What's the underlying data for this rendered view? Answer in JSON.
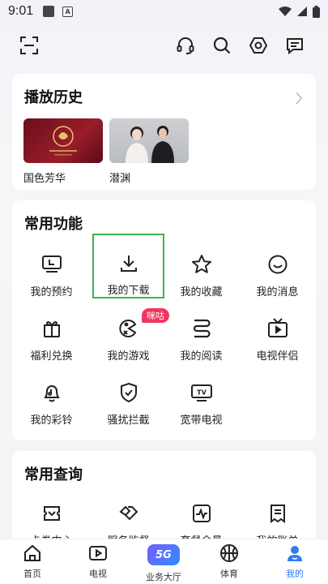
{
  "status_bar": {
    "time": "9:01",
    "notification_icon": "A"
  },
  "top_bar": {
    "icons": [
      "scan-icon",
      "headset-icon",
      "search-icon",
      "settings-icon",
      "message-icon"
    ]
  },
  "history": {
    "title": "播放历史",
    "items": [
      {
        "label": "国色芳华"
      },
      {
        "label": "潜渊"
      }
    ]
  },
  "functions": {
    "title": "常用功能",
    "items": [
      {
        "label": "我的预约",
        "icon": "tv-reserve-icon"
      },
      {
        "label": "我的下载",
        "icon": "download-icon"
      },
      {
        "label": "我的收藏",
        "icon": "star-icon"
      },
      {
        "label": "我的消息",
        "icon": "smile-message-icon"
      },
      {
        "label": "福利兑换",
        "icon": "gift-icon"
      },
      {
        "label": "我的游戏",
        "icon": "game-icon",
        "badge": "咪咕"
      },
      {
        "label": "我的阅读",
        "icon": "book-icon"
      },
      {
        "label": "电视伴侣",
        "icon": "tv-icon"
      },
      {
        "label": "我的彩铃",
        "icon": "bell-icon"
      },
      {
        "label": "骚扰拦截",
        "icon": "shield-icon"
      },
      {
        "label": "宽带电视",
        "icon": "tv-box-icon"
      }
    ]
  },
  "queries": {
    "title": "常用查询",
    "items": [
      {
        "label": "卡券中心",
        "icon": "coupon-icon"
      },
      {
        "label": "服务监督",
        "icon": "handshake-icon"
      },
      {
        "label": "套餐余量",
        "icon": "pulse-icon"
      },
      {
        "label": "我的账单",
        "icon": "bill-icon"
      }
    ]
  },
  "bottom_nav": {
    "items": [
      {
        "label": "首页"
      },
      {
        "label": "电视"
      },
      {
        "label": "业务大厅",
        "badge_text": "5G"
      },
      {
        "label": "体育"
      },
      {
        "label": "我的"
      }
    ]
  },
  "colors": {
    "accent": "#2f7cf6",
    "highlight": "#3bb54a",
    "badge": "#f0365f"
  }
}
